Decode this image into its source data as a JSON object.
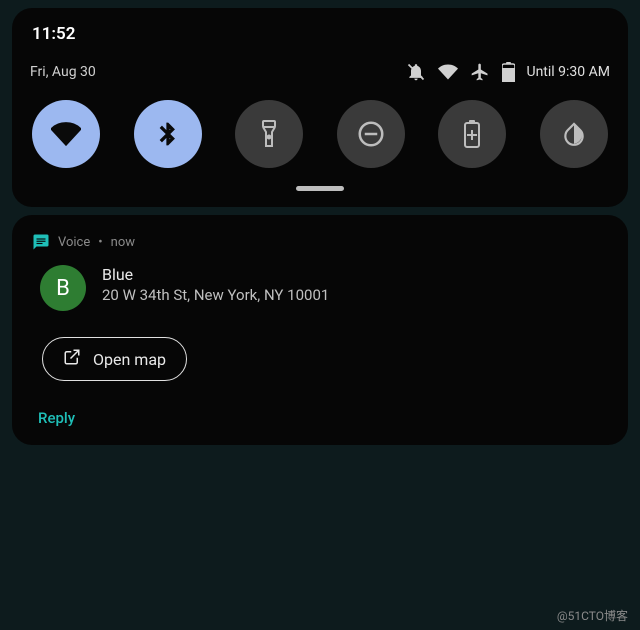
{
  "statusbar": {
    "time": "11:52",
    "date": "Fri, Aug 30",
    "until": "Until 9:30 AM"
  },
  "quicksettings": {
    "tiles": [
      {
        "name": "wifi",
        "on": true
      },
      {
        "name": "bluetooth",
        "on": true
      },
      {
        "name": "flashlight",
        "on": false
      },
      {
        "name": "do-not-disturb",
        "on": false
      },
      {
        "name": "battery-saver",
        "on": false
      },
      {
        "name": "dark-theme",
        "on": false
      }
    ]
  },
  "notification": {
    "app": "Voice",
    "time": "now",
    "avatar_letter": "B",
    "sender": "Blue",
    "message": "20 W 34th St, New York, NY 10001",
    "action_label": "Open map",
    "reply_label": "Reply"
  },
  "watermark": "@51CTO博客"
}
